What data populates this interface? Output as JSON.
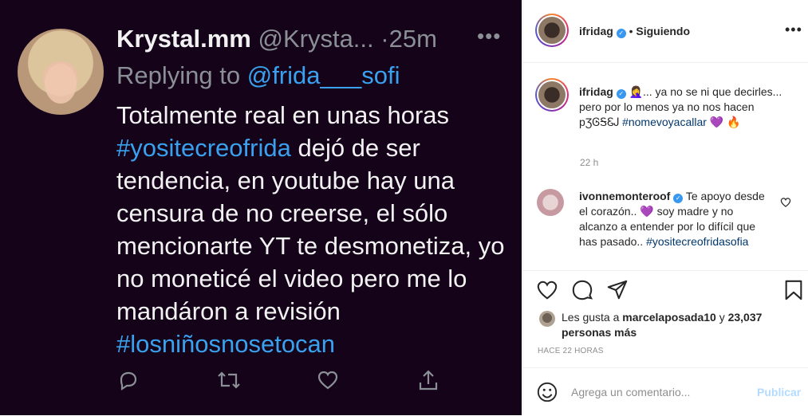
{
  "tweet": {
    "name": "Krystal.mm",
    "handle": "@Krysta...",
    "time": "25m",
    "more": "•••",
    "replying_prefix": "Replying to ",
    "replying_to": "@frida___sofi",
    "text_1": "Totalmente real en unas horas ",
    "hashtag_1": "#yositecreofrida",
    "text_2": " dejó de ser tendencia, en youtube hay una censura de no creerse, el sólo mencionarte YT te desmonetiza, yo no moneticé el video pero me lo mandáron a revisión ",
    "hashtag_2": "#losniñosnosetocan",
    "colors": {
      "background": "#15031a",
      "text": "#f2f2f2",
      "muted": "#8b8f96",
      "link": "#3aa1ef"
    },
    "action_icons": [
      "reply-icon",
      "retweet-icon",
      "like-icon",
      "share-icon"
    ]
  },
  "post": {
    "username": "ifridag",
    "verified_badge": "✓",
    "following": "Siguiendo",
    "dot": "•",
    "more": "•••",
    "caption": {
      "emoji": "🤦‍♀️",
      "text": "... ya no se ni que decirles... pero por lo menos ya no nos hacen pƷᎶᎦᏋᎫ ",
      "hashtag": "#nomevoyacallar",
      "emoji_end": " 💜 🔥",
      "time": "22 h"
    },
    "comment": {
      "username": "ivonnemonteroof",
      "text_1": " Te apoyo desde el corazón.. ",
      "emoji": "💜",
      "text_2": " soy madre y no alcanzo a entender por lo difícil que has pasado.. ",
      "hashtag": "#yositecreofridasofia"
    },
    "likes": {
      "prefix": "Les gusta a ",
      "user": "marcelaposada10",
      "middle": " y ",
      "count": "23,037 personas más"
    },
    "ago": "HACE 22 HORAS",
    "add_comment_placeholder": "Agrega un comentario...",
    "publish": "Publicar",
    "icons": [
      "heart-icon",
      "comment-icon",
      "share-icon",
      "bookmark-icon",
      "emoji-icon"
    ],
    "colors": {
      "link": "#00376b",
      "muted": "#8e8e8e",
      "verified": "#3897f0",
      "publish": "#b3dbff"
    }
  }
}
